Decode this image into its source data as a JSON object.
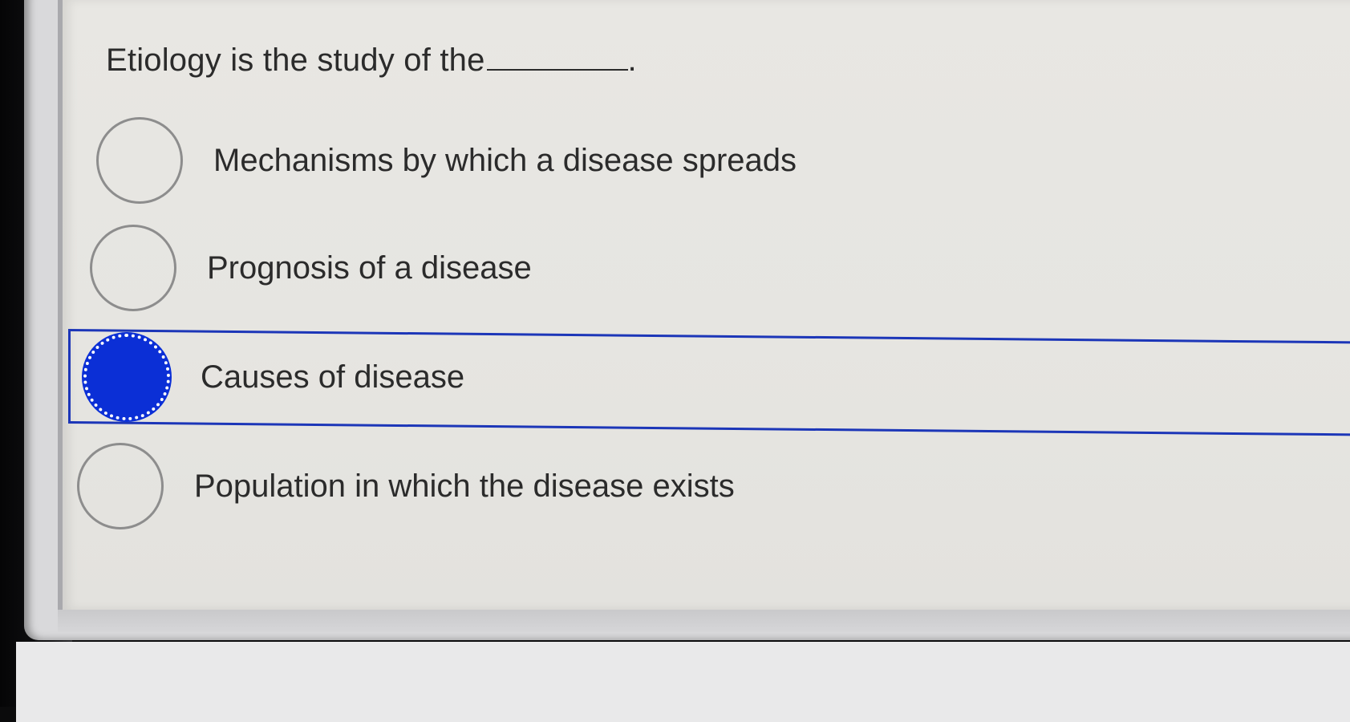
{
  "question": {
    "text": "Etiology is the study of the",
    "end_punct": "."
  },
  "options": [
    {
      "label": "Mechanisms by which a disease spreads",
      "selected": false
    },
    {
      "label": "Prognosis of a disease",
      "selected": false
    },
    {
      "label": "Causes of disease",
      "selected": true
    },
    {
      "label": "Population in which the disease exists",
      "selected": false
    }
  ],
  "colors": {
    "selected_radio": "#0b2fd6",
    "selection_frame": "#1c36b8",
    "text": "#2b2b2b",
    "panel_bg": "#e8e7e3"
  }
}
